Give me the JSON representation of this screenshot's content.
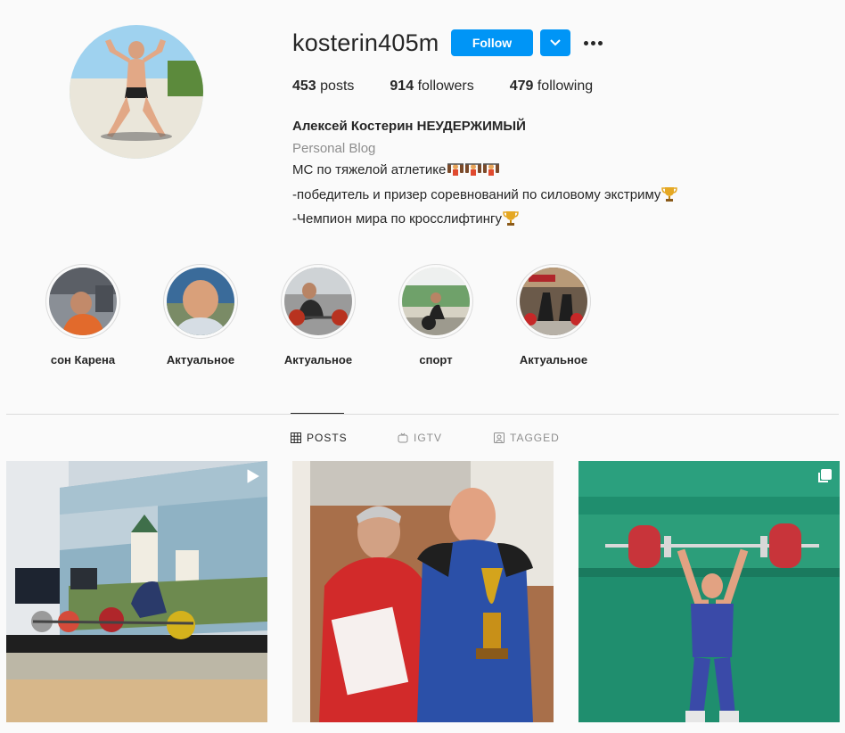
{
  "profile": {
    "username": "kosterin405m",
    "follow_label": "Follow",
    "stats": {
      "posts_count": "453",
      "posts_label": "posts",
      "followers_count": "914",
      "followers_label": "followers",
      "following_count": "479",
      "following_label": "following"
    },
    "full_name": "Алексей Костерин НЕУДЕРЖИМЫЙ",
    "category": "Personal Blog",
    "bio_lines": [
      "МС по тяжелой атлетике",
      "-победитель и призер соревнований по силовому экстриму",
      "-Чемпион мира по кросслифтингу"
    ]
  },
  "highlights": [
    {
      "label": "сон Карена"
    },
    {
      "label": "Актуальное"
    },
    {
      "label": "Актуальное"
    },
    {
      "label": "спорт"
    },
    {
      "label": "Актуальное"
    }
  ],
  "tabs": [
    {
      "label": "POSTS",
      "icon": "grid-icon",
      "active": true
    },
    {
      "label": "IGTV",
      "icon": "igtv-icon",
      "active": false
    },
    {
      "label": "TAGGED",
      "icon": "tagged-icon",
      "active": false
    }
  ],
  "posts": [
    {
      "badge": "video-icon"
    },
    {
      "badge": ""
    },
    {
      "badge": "carousel-icon"
    }
  ],
  "colors": {
    "accent": "#0095f6",
    "background": "#fafafa",
    "text": "#262626",
    "muted": "#8e8e8e",
    "border": "#dbdbdb"
  }
}
